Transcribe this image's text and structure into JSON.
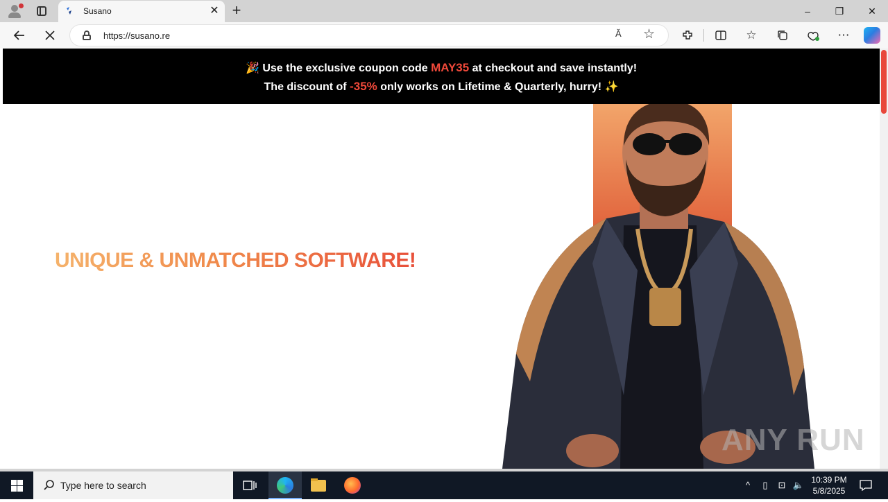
{
  "browser": {
    "tab_title": "Susano",
    "url": "https://susano.re",
    "read_aloud_label": "Ă",
    "new_tab_label": "+",
    "tab_close_label": "✕"
  },
  "window_controls": {
    "minimize": "–",
    "restore": "❐",
    "close": "✕"
  },
  "banner": {
    "line1_emoji": "🎉",
    "line1_pre": "Use the exclusive coupon code",
    "coupon_code": "MAY35",
    "line1_post": "at checkout and save instantly!",
    "line2_pre": "The discount of",
    "discount": "-35%",
    "line2_post": "only works on Lifetime & Quarterly, hurry!",
    "line2_emoji": "✨"
  },
  "hero": {
    "headline": "UNIQUE & UNMATCHED SOFTWARE!"
  },
  "watermark": "ANY RUN",
  "taskbar": {
    "search_placeholder": "Type here to search",
    "time": "10:39 PM",
    "date": "5/8/2025"
  },
  "colors": {
    "accent_red": "#f0493a",
    "headline_gradient_start": "#f5b26b",
    "headline_gradient_end": "#e8503a",
    "banner_bg": "#000000"
  }
}
